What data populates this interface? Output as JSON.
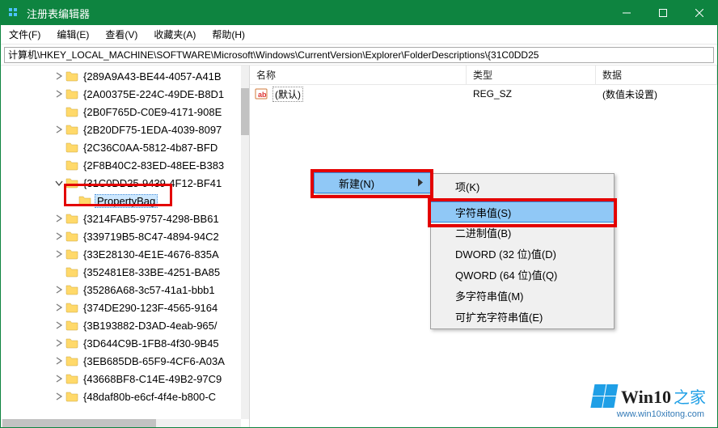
{
  "title": "注册表编辑器",
  "menu": {
    "file": "文件(F)",
    "edit": "编辑(E)",
    "view": "查看(V)",
    "favorites": "收藏夹(A)",
    "help": "帮助(H)"
  },
  "address": "计算机\\HKEY_LOCAL_MACHINE\\SOFTWARE\\Microsoft\\Windows\\CurrentVersion\\Explorer\\FolderDescriptions\\{31C0DD25",
  "columns": {
    "name": "名称",
    "type": "类型",
    "data": "数据"
  },
  "default_row": {
    "name": "(默认)",
    "type": "REG_SZ",
    "data": "(数值未设置)"
  },
  "tree": [
    {
      "indent": 64,
      "expand": "closed",
      "label": "{289A9A43-BE44-4057-A41B"
    },
    {
      "indent": 64,
      "expand": "closed",
      "label": "{2A00375E-224C-49DE-B8D1"
    },
    {
      "indent": 64,
      "expand": "none",
      "label": "{2B0F765D-C0E9-4171-908E"
    },
    {
      "indent": 64,
      "expand": "closed",
      "label": "{2B20DF75-1EDA-4039-8097"
    },
    {
      "indent": 64,
      "expand": "none",
      "label": "{2C36C0AA-5812-4b87-BFD"
    },
    {
      "indent": 64,
      "expand": "none",
      "label": "{2F8B40C2-83ED-48EE-B383"
    },
    {
      "indent": 64,
      "expand": "open",
      "label": "{31C0DD25-9439-4F12-BF41"
    },
    {
      "indent": 80,
      "expand": "none",
      "label": "PropertyBag",
      "selected": true
    },
    {
      "indent": 64,
      "expand": "closed",
      "label": "{3214FAB5-9757-4298-BB61"
    },
    {
      "indent": 64,
      "expand": "closed",
      "label": "{339719B5-8C47-4894-94C2"
    },
    {
      "indent": 64,
      "expand": "closed",
      "label": "{33E28130-4E1E-4676-835A"
    },
    {
      "indent": 64,
      "expand": "none",
      "label": "{352481E8-33BE-4251-BA85"
    },
    {
      "indent": 64,
      "expand": "closed",
      "label": "{35286A68-3c57-41a1-bbb1"
    },
    {
      "indent": 64,
      "expand": "closed",
      "label": "{374DE290-123F-4565-9164"
    },
    {
      "indent": 64,
      "expand": "closed",
      "label": "{3B193882-D3AD-4eab-965/"
    },
    {
      "indent": 64,
      "expand": "closed",
      "label": "{3D644C9B-1FB8-4f30-9B45"
    },
    {
      "indent": 64,
      "expand": "closed",
      "label": "{3EB685DB-65F9-4CF6-A03A"
    },
    {
      "indent": 64,
      "expand": "closed",
      "label": "{43668BF8-C14E-49B2-97C9"
    },
    {
      "indent": 64,
      "expand": "closed",
      "label": "{48daf80b-e6cf-4f4e-b800-C"
    }
  ],
  "context": {
    "new": "新建(N)",
    "submenu": {
      "key": "项(K)",
      "string": "字符串值(S)",
      "binary": "二进制值(B)",
      "dword": "DWORD (32 位)值(D)",
      "qword": "QWORD (64 位)值(Q)",
      "multi": "多字符串值(M)",
      "expand": "可扩充字符串值(E)"
    }
  },
  "watermark": {
    "brand1": "Win10",
    "brand2": "之家",
    "url": "www.win10xitong.com"
  }
}
